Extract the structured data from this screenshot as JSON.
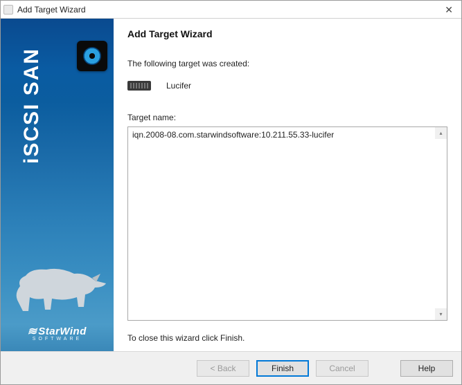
{
  "window": {
    "title": "Add Target Wizard"
  },
  "sidebar": {
    "product": "iSCSI SAN",
    "brand": "StarWind",
    "brand_sub": "SOFTWARE"
  },
  "main": {
    "heading": "Add Target Wizard",
    "created_text": "The following target was created:",
    "target_alias": "Lucifer",
    "target_name_label": "Target name:",
    "target_name_value": "iqn.2008-08.com.starwindsoftware:10.211.55.33-lucifer",
    "close_text": "To close this wizard click Finish."
  },
  "footer": {
    "back": "< Back",
    "finish": "Finish",
    "cancel": "Cancel",
    "help": "Help"
  }
}
